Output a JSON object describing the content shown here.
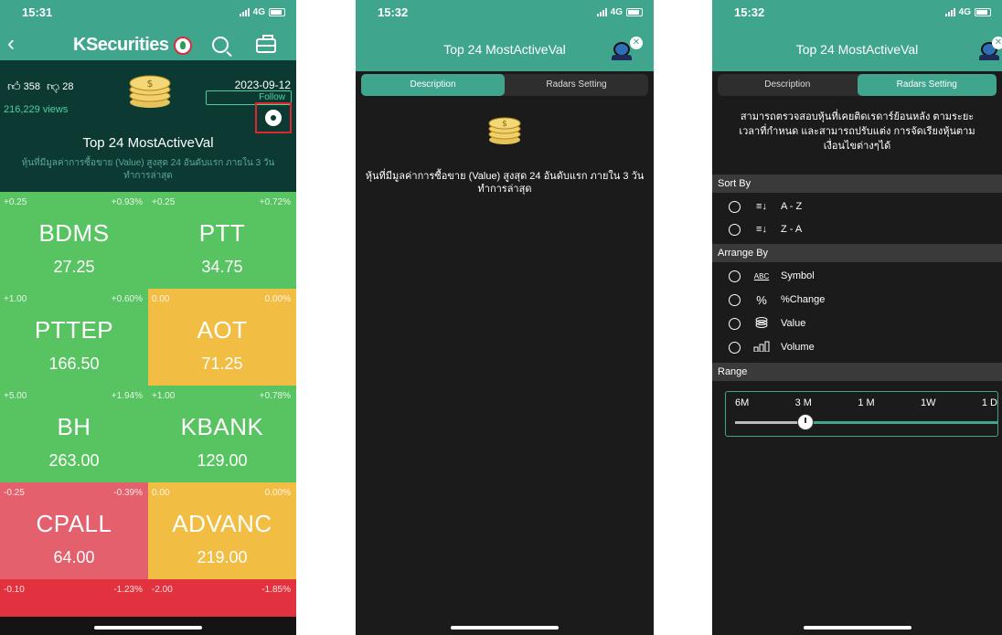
{
  "phone1": {
    "status": {
      "time": "15:31",
      "network": "4G"
    },
    "brand": "KSecurities",
    "likes": "358",
    "dislikes": "28",
    "views": "216,229 views",
    "date": "2023-09-12",
    "follow_label": "Follow",
    "title": "Top 24 MostActiveVal",
    "description": "หุ้นที่มีมูลค่าการซื้อขาย (Value) สูงสุด 24 อันดับแรก ภายใน 3 วันทำการล่าสุด",
    "tiles": [
      {
        "symbol": "BDMS",
        "change": "+0.25",
        "pct": "+0.93%",
        "price": "27.25",
        "color": "green"
      },
      {
        "symbol": "PTT",
        "change": "+0.25",
        "pct": "+0.72%",
        "price": "34.75",
        "color": "green"
      },
      {
        "symbol": "PTTEP",
        "change": "+1.00",
        "pct": "+0.60%",
        "price": "166.50",
        "color": "green"
      },
      {
        "symbol": "AOT",
        "change": "0.00",
        "pct": "0.00%",
        "price": "71.25",
        "color": "yellow"
      },
      {
        "symbol": "BH",
        "change": "+5.00",
        "pct": "+1.94%",
        "price": "263.00",
        "color": "green"
      },
      {
        "symbol": "KBANK",
        "change": "+1.00",
        "pct": "+0.78%",
        "price": "129.00",
        "color": "green"
      },
      {
        "symbol": "CPALL",
        "change": "-0.25",
        "pct": "-0.39%",
        "price": "64.00",
        "color": "red"
      },
      {
        "symbol": "ADVANC",
        "change": "0.00",
        "pct": "0.00%",
        "price": "219.00",
        "color": "yellow"
      },
      {
        "symbol": "",
        "change": "-0.10",
        "pct": "-1.23%",
        "price": "",
        "color": "red2"
      },
      {
        "symbol": "",
        "change": "-2.00",
        "pct": "-1.85%",
        "price": "",
        "color": "red2"
      }
    ]
  },
  "phone2": {
    "status": {
      "time": "15:32",
      "network": "4G"
    },
    "title": "Top 24 MostActiveVal",
    "tab_description": "Description",
    "tab_radars": "Radars Setting",
    "description": "หุ้นที่มีมูลค่าการซื้อขาย (Value) สูงสุด 24 อันดับแรก ภายใน 3 วันทำการล่าสุด"
  },
  "phone3": {
    "status": {
      "time": "15:32",
      "network": "4G"
    },
    "title": "Top 24 MostActiveVal",
    "tab_description": "Description",
    "tab_radars": "Radars Setting",
    "intro": "สามารถตรวจสอบหุ้นที่เคยติดเรดาร์ย้อนหลัง ตามระยะเวลาที่กำหนด และสามารถปรับแต่ง การจัดเรียงหุ้นตามเงื่อนไขต่างๆได้",
    "sort_by_label": "Sort By",
    "sort_options": [
      "A - Z",
      "Z - A"
    ],
    "arrange_by_label": "Arrange By",
    "arrange_options": [
      "Symbol",
      "%Change",
      "Value",
      "Volume"
    ],
    "range_label": "Range",
    "range_options": [
      "6M",
      "3 M",
      "1 M",
      "1W",
      "1 D"
    ],
    "range_selected_index": 1,
    "icon_abc": "ABC",
    "icon_pct": "%"
  },
  "colors": {
    "teal": "#3fa58c",
    "dark": "#1b1b1b",
    "green": "#58c361",
    "yellow": "#f2bd43",
    "red": "#e4606c"
  }
}
